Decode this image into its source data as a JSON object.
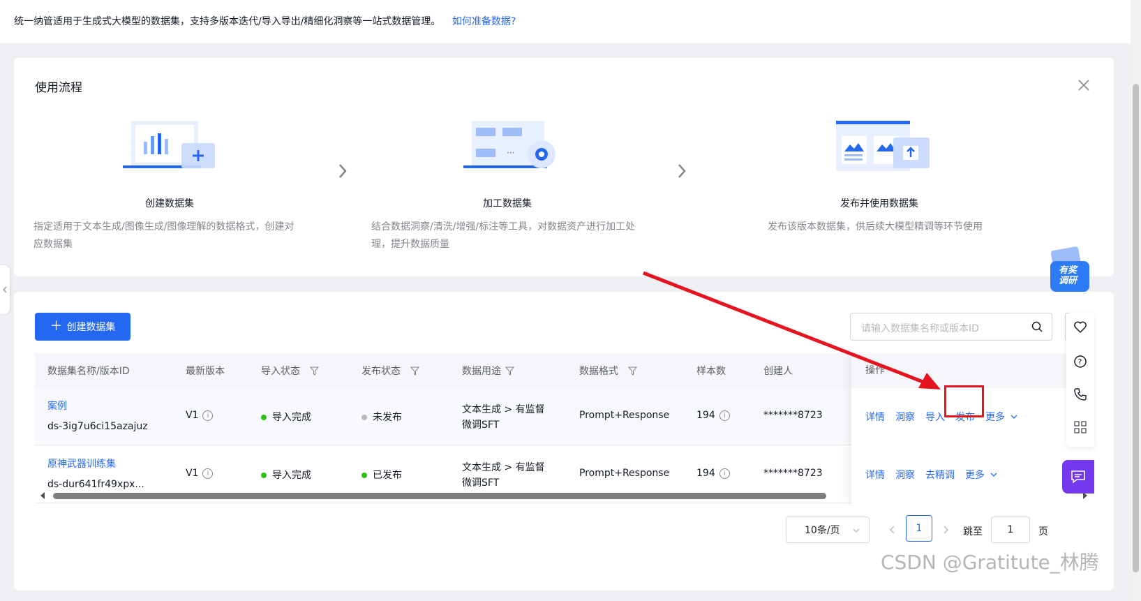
{
  "header": {
    "description": "统一纳管适用于生成式大模型的数据集，支持多版本迭代/导入导出/精细化洞察等一站式数据管理。",
    "help_link": "如何准备数据?"
  },
  "flow": {
    "title": "使用流程",
    "steps": [
      {
        "name": "创建数据集",
        "desc_line1": "指定适用于文本生成/图像生成/图像理解的数据格式，创建对",
        "desc_line2": "应数据集"
      },
      {
        "name": "加工数据集",
        "desc_line1": "结合数据洞察/清洗/增强/标注等工具，对数据资产进行加工处",
        "desc_line2": "理，提升数据质量"
      },
      {
        "name": "发布并使用数据集",
        "desc_line1": "发布该版本数据集，供后续大模型精调等环节使用",
        "desc_line2": ""
      }
    ]
  },
  "toolbar": {
    "create_label": "创建数据集",
    "search_placeholder": "请输入数据集名称或版本ID"
  },
  "table": {
    "columns": [
      "数据集名称/版本ID",
      "最新版本",
      "导入状态",
      "发布状态",
      "数据用途",
      "数据格式",
      "样本数",
      "创建人",
      "操作"
    ],
    "rows": [
      {
        "name": "案例",
        "id": "ds-3ig7u6ci15azajuz",
        "version": "V1",
        "import_status": "导入完成",
        "publish_status": "未发布",
        "publish_color": "#b8babf",
        "usage_line1": "文本生成 > 有监督",
        "usage_line2": "微调SFT",
        "format": "Prompt+Response",
        "samples": "194",
        "creator": "*******8723",
        "ops": [
          "详情",
          "洞察",
          "导入",
          "发布",
          "更多"
        ]
      },
      {
        "name": "原神武器训练集",
        "id": "ds-dur641fr49xpx...",
        "version": "V1",
        "import_status": "导入完成",
        "publish_status": "已发布",
        "publish_color": "#30bf13",
        "usage_line1": "文本生成 > 有监督",
        "usage_line2": "微调SFT",
        "format": "Prompt+Response",
        "samples": "194",
        "creator": "*******8723",
        "ops": [
          "详情",
          "洞察",
          "去精调",
          "更多"
        ]
      }
    ]
  },
  "pagination": {
    "page_size": "10条/页",
    "current_page": "1",
    "jump_label": "跳至",
    "jump_value": "1",
    "page_unit": "页"
  },
  "survey_badge": {
    "line1": "有奖",
    "line2": "调研"
  },
  "watermark": "CSDN @Gratitute_林腾",
  "colors": {
    "primary": "#2468f2",
    "success": "#30bf13",
    "annotation": "#e5151f",
    "chat": "#7438ee"
  }
}
